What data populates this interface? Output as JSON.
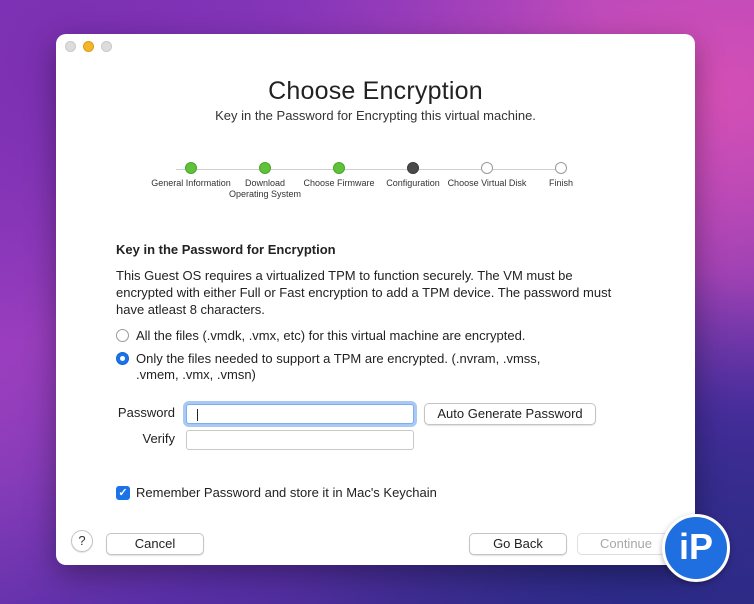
{
  "window": {
    "title": "Choose Encryption",
    "subtitle": "Key in the Password for Encrypting this virtual machine."
  },
  "steps": [
    {
      "label": "General Information",
      "state": "done"
    },
    {
      "label": "Download Operating System",
      "state": "done"
    },
    {
      "label": "Choose Firmware",
      "state": "done"
    },
    {
      "label": "Configuration",
      "state": "current"
    },
    {
      "label": "Choose Virtual Disk",
      "state": "todo"
    },
    {
      "label": "Finish",
      "state": "todo"
    }
  ],
  "section": {
    "title": "Key in the Password for Encryption",
    "description": "This Guest OS requires a virtualized TPM to function securely. The VM must be encrypted with either Full or Fast encryption to add a TPM device. The password must have atleast 8 characters."
  },
  "options": [
    {
      "label": "All the files (.vmdk, .vmx, etc) for this virtual machine are encrypted.",
      "selected": false
    },
    {
      "label": "Only the files needed to support a TPM are encrypted. (.nvram, .vmss, .vmem, .vmx, .vmsn)",
      "selected": true
    }
  ],
  "form": {
    "password_label": "Password",
    "password_value": "",
    "verify_label": "Verify",
    "verify_value": "",
    "auto_generate_label": "Auto Generate Password"
  },
  "keychain": {
    "label": "Remember Password and store it in Mac's Keychain",
    "checked": true
  },
  "footer": {
    "help_label": "?",
    "cancel_label": "Cancel",
    "back_label": "Go Back",
    "continue_label": "Continue"
  },
  "badge": {
    "text": "iP"
  },
  "colors": {
    "accent": "#1a73e8",
    "step_done": "#5fc23a",
    "step_current": "#4a4a4a"
  }
}
